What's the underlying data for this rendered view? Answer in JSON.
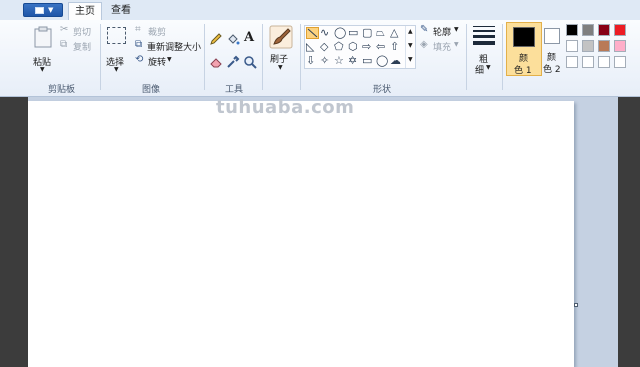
{
  "tabs": {
    "home": "主页",
    "view": "查看"
  },
  "clipboard": {
    "group": "剪贴板",
    "paste": "粘贴",
    "cut": "剪切",
    "copy": "复制"
  },
  "image": {
    "group": "图像",
    "select": "选择",
    "crop": "裁剪",
    "resize": "重新调整大小",
    "rotate": "旋转"
  },
  "tools": {
    "group": "工具"
  },
  "brushes": {
    "label": "刷子"
  },
  "shapes": {
    "group": "形状",
    "outline": "轮廓",
    "fill": "填充"
  },
  "size": {
    "label_line1": "粗",
    "label_line2": "细"
  },
  "colors": {
    "color1_line1": "颜",
    "color1_line2": "色 1",
    "color2_line1": "颜",
    "color2_line2": "色 2",
    "color1_value": "#000000",
    "color2_value": "#ffffff",
    "palette_row1": [
      "#000000",
      "#7f7f7f",
      "#880015",
      "#ed1c24"
    ],
    "palette_row2": [
      "#ffffff",
      "#c3c3c3",
      "#b97a57",
      "#ffaec9"
    ],
    "palette_row3": [
      "#ffffff",
      "#ffffff",
      "#ffffff",
      "#ffffff"
    ]
  },
  "watermark": "tuhuaba.com"
}
